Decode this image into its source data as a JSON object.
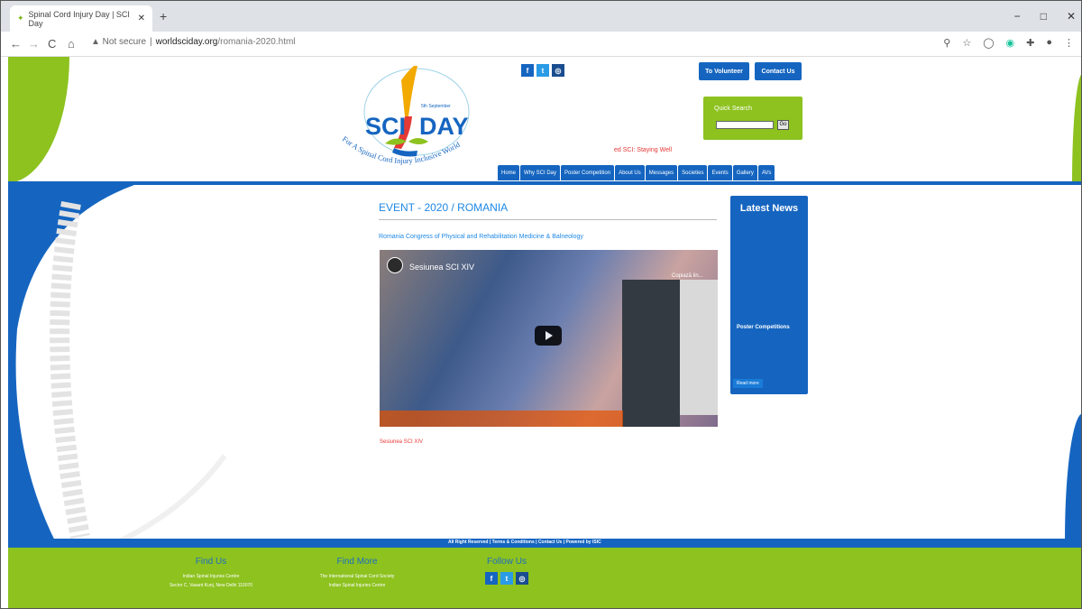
{
  "browser": {
    "tab_title": "Spinal Cord Injury Day | SCI Day",
    "tab_close": "✕",
    "new_tab": "+",
    "back": "←",
    "forward": "→",
    "reload": "C",
    "home": "⌂",
    "security": "▲ Not secure",
    "domain": "worldsciday.org",
    "path": "/romania-2020.html",
    "win_min": "−",
    "win_max": "□",
    "win_close": "✕"
  },
  "header": {
    "logo_date": "5th September",
    "logo_text_left": "SCI",
    "logo_text_right": "DAY",
    "logo_motto": "For A Spinal Cord Injury Inclusive World",
    "social": [
      "f",
      "t",
      "◎"
    ],
    "volunteer_button": "To Volunteer",
    "contact_button": "Contact Us",
    "quick_search_label": "Quick Search",
    "search_go": "Go",
    "tagline": "ed SCI: Staying Well",
    "nav": [
      "Home",
      "Why SCI Day",
      "Poster Competition",
      "About Us",
      "Messages",
      "Societies",
      "Events",
      "Gallery",
      "AVs"
    ]
  },
  "content": {
    "event_title": "EVENT - 2020 / ROMANIA",
    "event_subtitle": "Romania Congress of Physical and Rehabilitation Medicine & Balneology",
    "video_title": "Sesiunea SCI XIV",
    "video_copy": "Copiază lin...",
    "caption": "Sesiunea SCI XIV"
  },
  "news": {
    "heading": "Latest News",
    "item": "Poster Competitions",
    "read_more": "Read more"
  },
  "footer": {
    "bar_text": "All Right Reserved  |  Terms & Conditions  |  Contact Us  |  Powered by ISIC",
    "find_us_heading": "Find Us",
    "find_us_line1": "Indian Spinal Injuries Centre",
    "find_us_line2": "Sector C, Vasant Kunj, New Delhi 110070",
    "find_more_heading": "Find More",
    "find_more_line1": "The International Spinal Cord Society",
    "find_more_line2": "Indian Spinal Injuries Centre",
    "follow_heading": "Follow Us",
    "social": [
      "f",
      "t",
      "◎"
    ]
  },
  "colors": {
    "brand_blue": "#1565c0",
    "brand_green": "#8dc21f",
    "accent_red": "#e53935"
  }
}
